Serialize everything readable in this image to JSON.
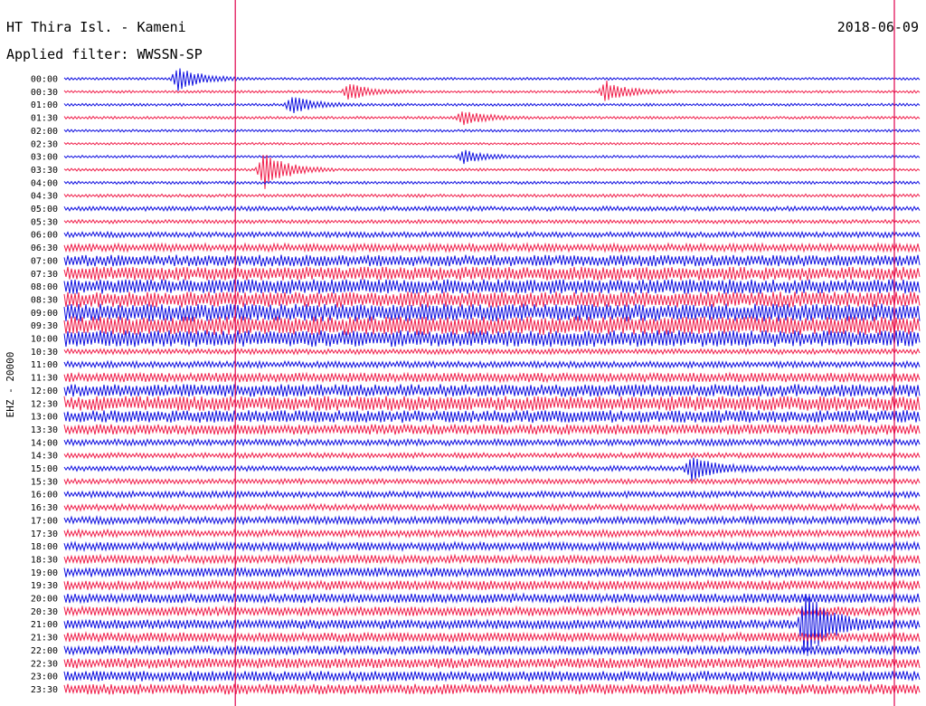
{
  "header": {
    "station": "HT Thira Isl. - Kameni",
    "filter": "Applied filter: WWSSN-SP",
    "date": "2018-06-09"
  },
  "chart_data": {
    "type": "line",
    "title": "HT Thira Isl. - Kameni",
    "ylabel": "EHZ - 20000",
    "rows": [
      "00:00",
      "00:30",
      "01:00",
      "01:30",
      "02:00",
      "02:30",
      "03:00",
      "03:30",
      "04:00",
      "04:30",
      "05:00",
      "05:30",
      "06:00",
      "06:30",
      "07:00",
      "07:30",
      "08:00",
      "08:30",
      "09:00",
      "09:30",
      "10:00",
      "10:30",
      "11:00",
      "11:30",
      "12:00",
      "12:30",
      "13:00",
      "13:30",
      "14:00",
      "14:30",
      "15:00",
      "15:30",
      "16:00",
      "16:30",
      "17:00",
      "17:30",
      "18:00",
      "18:30",
      "19:00",
      "19:30",
      "20:00",
      "20:30",
      "21:00",
      "21:30",
      "22:00",
      "22:30",
      "23:00",
      "23:30"
    ],
    "row_amplitude": [
      1.2,
      1.2,
      1.3,
      1.3,
      1.2,
      1.1,
      1.2,
      1.3,
      1.4,
      1.5,
      2.2,
      1.8,
      2.6,
      3.8,
      5.5,
      6.5,
      7.0,
      7.5,
      8.5,
      9.0,
      8.0,
      2.5,
      3.0,
      4.5,
      6.0,
      7.0,
      6.0,
      5.0,
      3.0,
      2.5,
      2.5,
      2.5,
      3.0,
      3.0,
      3.5,
      3.5,
      4.0,
      4.0,
      4.5,
      4.5,
      4.5,
      4.5,
      4.5,
      4.5,
      4.5,
      5.0,
      5.0,
      5.0
    ],
    "events": [
      {
        "row": "00:00",
        "minute": 4,
        "amplitude": 14
      },
      {
        "row": "00:30",
        "minute": 10,
        "amplitude": 9
      },
      {
        "row": "00:30",
        "minute": 19,
        "amplitude": 12
      },
      {
        "row": "01:00",
        "minute": 8,
        "amplitude": 10
      },
      {
        "row": "01:30",
        "minute": 14,
        "amplitude": 8
      },
      {
        "row": "03:00",
        "minute": 14,
        "amplitude": 7
      },
      {
        "row": "03:30",
        "minute": 7,
        "amplitude": 22
      },
      {
        "row": "15:00",
        "minute": 22,
        "amplitude": 14
      },
      {
        "row": "21:00",
        "minute": 26,
        "amplitude": 40
      }
    ],
    "colors": [
      "#1010e0",
      "#f0204c"
    ],
    "pen_color": "#e0004c",
    "pen_lines_minute": [
      6,
      30
    ]
  }
}
